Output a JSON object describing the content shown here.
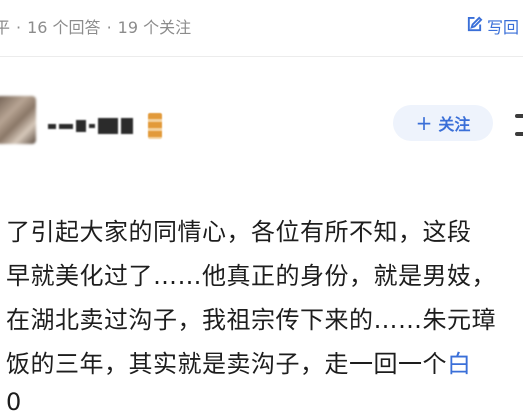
{
  "question_meta": {
    "answers": "16 个回答",
    "separator": "·",
    "followers": "19 个关注",
    "write_answer": "写回"
  },
  "author": {
    "follow_label": "关注",
    "follow_plus": "+"
  },
  "answer": {
    "lines": [
      "了引起大家的同情心，各位有所不知，这段",
      "早就美化过了……他真正的身份，就是男妓，",
      "在湖北卖过沟子，我祖宗传下来的……朱元璋",
      "饭的三年，其实就是卖沟子，走一回一个"
    ],
    "line4_link": "白",
    "line5_partial": "0"
  },
  "colors": {
    "accent": "#3a6fd8",
    "follow_bg": "#eef3fc",
    "meta_text": "#8c8c8c"
  }
}
